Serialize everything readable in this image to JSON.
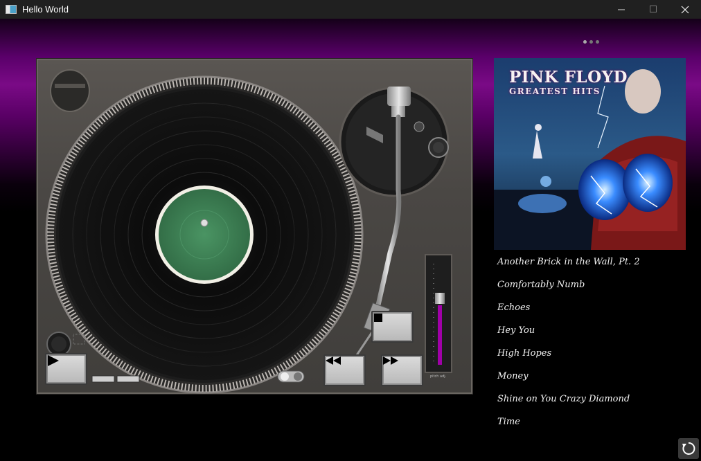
{
  "window": {
    "title": "Hello World",
    "controls": [
      "minimize-icon",
      "maximize-icon",
      "close-icon"
    ]
  },
  "carousel": {
    "page_count": 3,
    "active_index": 0
  },
  "player": {
    "buttons": [
      "play-icon",
      "stop-icon",
      "rewind-icon",
      "fast-forward-icon"
    ],
    "pitch_label": "pitch adj."
  },
  "album": {
    "title_line1": "PINK FLOYD",
    "title_line2": "GREATEST HITS"
  },
  "tracks": [
    "Another Brick in the Wall, Pt. 2",
    "Comfortably Numb",
    "Echoes",
    "Hey You",
    "High Hopes",
    "Money",
    "Shine on You Crazy Diamond",
    "Time"
  ],
  "footer": {
    "icon": "refresh-icon"
  },
  "colors": {
    "accent": "#7a0a86",
    "label_green": "#3f8656",
    "pitch_bar": "#a000a8"
  }
}
